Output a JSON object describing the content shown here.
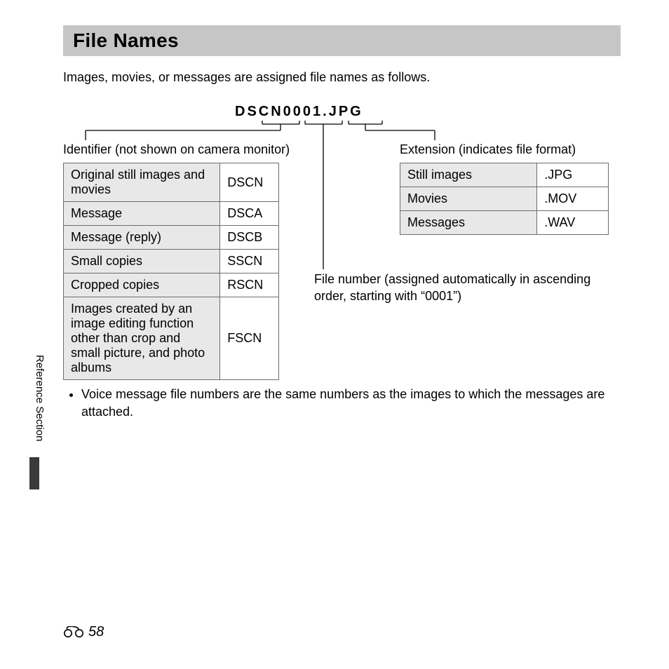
{
  "title": "File Names",
  "intro": "Images, movies, or messages are assigned file names as follows.",
  "exampleFilename": "DSCN0001.JPG",
  "identifier": {
    "label": "Identifier (not shown on camera monitor)",
    "rows": [
      {
        "desc": "Original still images and movies",
        "code": "DSCN"
      },
      {
        "desc": "Message",
        "code": "DSCA"
      },
      {
        "desc": "Message (reply)",
        "code": "DSCB"
      },
      {
        "desc": "Small copies",
        "code": "SSCN"
      },
      {
        "desc": "Cropped copies",
        "code": "RSCN"
      },
      {
        "desc": "Images created by an image editing function other than crop and small picture, and photo albums",
        "code": "FSCN"
      }
    ]
  },
  "extension": {
    "label": "Extension (indicates file format)",
    "rows": [
      {
        "desc": "Still images",
        "code": ".JPG"
      },
      {
        "desc": "Movies",
        "code": ".MOV"
      },
      {
        "desc": "Messages",
        "code": ".WAV"
      }
    ]
  },
  "fileNumberLabel": "File number (assigned automatically in ascending order, starting with “0001”)",
  "bullets": [
    "Voice message file numbers are the same numbers as the images to which the messages are attached."
  ],
  "sideLabel": "Reference Section",
  "pageNumber": "58"
}
